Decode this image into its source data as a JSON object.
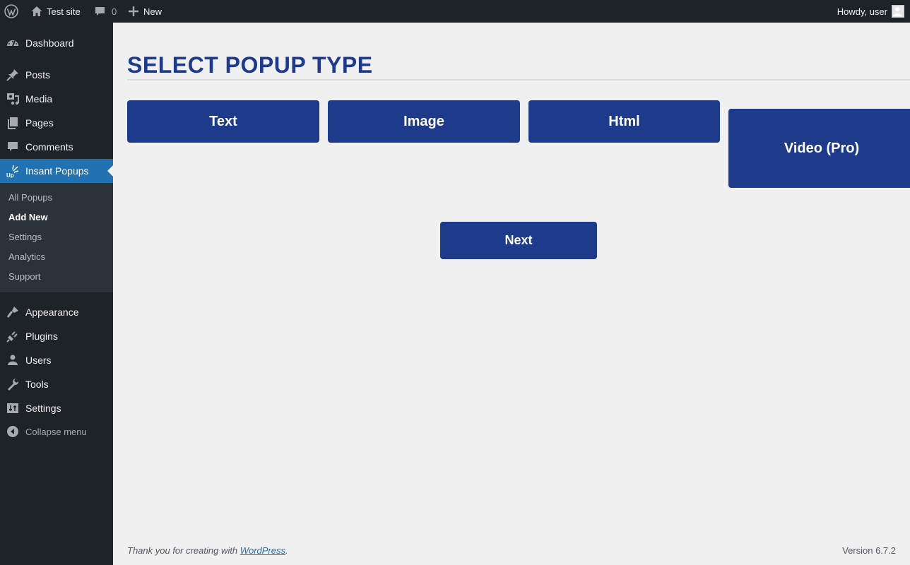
{
  "adminbar": {
    "site_name": "Test site",
    "comments_count": "0",
    "new_label": "New",
    "howdy": "Howdy, user"
  },
  "sidebar": {
    "items": [
      {
        "label": "Dashboard",
        "icon": "dashboard-icon"
      },
      {
        "label": "Posts",
        "icon": "pin-icon"
      },
      {
        "label": "Media",
        "icon": "media-icon"
      },
      {
        "label": "Pages",
        "icon": "pages-icon"
      },
      {
        "label": "Comments",
        "icon": "comment-icon"
      },
      {
        "label": "Insant Popups",
        "icon": "popup-plugin-icon"
      },
      {
        "label": "Appearance",
        "icon": "brush-icon"
      },
      {
        "label": "Plugins",
        "icon": "plug-icon"
      },
      {
        "label": "Users",
        "icon": "user-icon"
      },
      {
        "label": "Tools",
        "icon": "wrench-icon"
      },
      {
        "label": "Settings",
        "icon": "settings-icon"
      }
    ],
    "submenu": [
      "All Popups",
      "Add New",
      "Settings",
      "Analytics",
      "Support"
    ],
    "collapse": "Collapse menu"
  },
  "main": {
    "title": "SELECT POPUP TYPE",
    "types": [
      "Text",
      "Image",
      "Html",
      "Video (Pro)"
    ],
    "next": "Next"
  },
  "footer": {
    "thanks_prefix": "Thank you for creating with ",
    "link": "WordPress",
    "suffix": ".",
    "version": "Version 6.7.2"
  },
  "colors": {
    "accent": "#1e3a8a",
    "admin_bar": "#1d2327",
    "current_menu": "#2271b1"
  }
}
